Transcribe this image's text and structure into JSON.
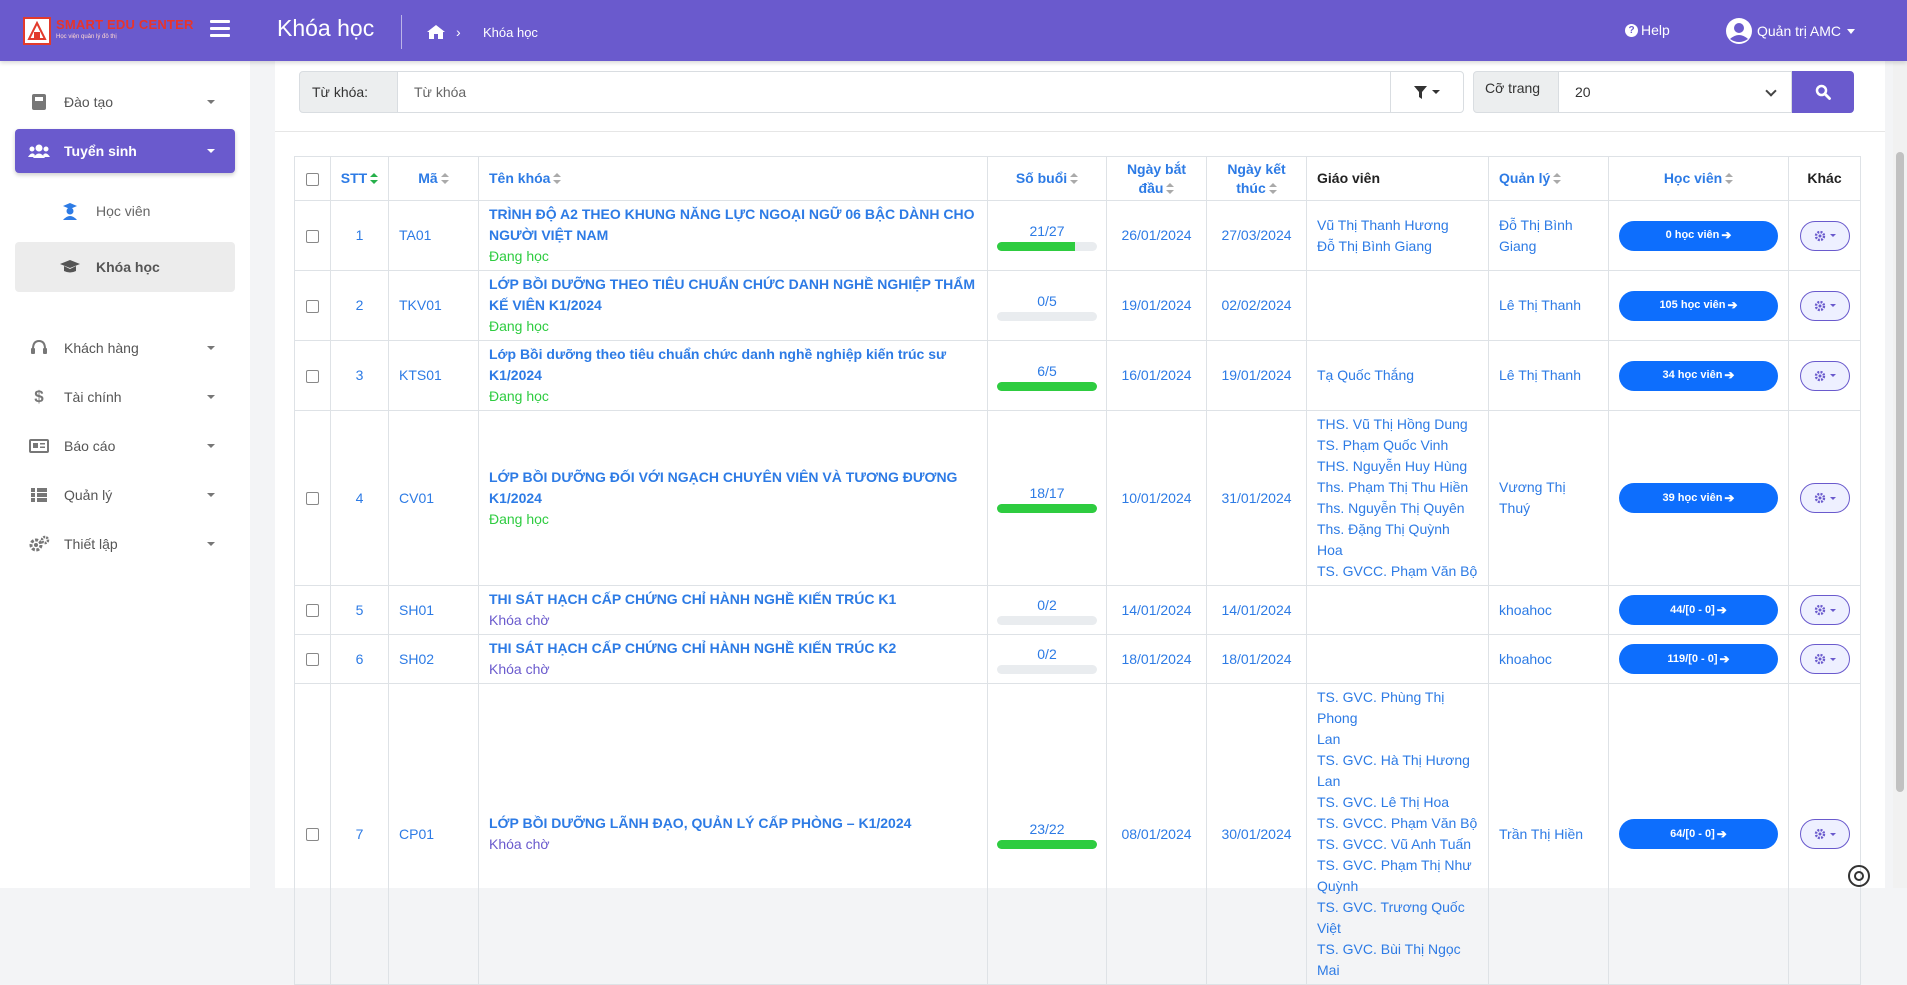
{
  "brand": {
    "title": "SMART EDU CENTER",
    "subtitle": "Học viện quản lý đô thị"
  },
  "header": {
    "page_title": "Khóa học",
    "breadcrumb_current": "Khóa học",
    "help": "Help",
    "user": "Quản trị AMC"
  },
  "sidebar": {
    "items": [
      {
        "label": "Đào tạo",
        "icon": "book-icon"
      },
      {
        "label": "Tuyển sinh",
        "icon": "users-icon",
        "active": true
      },
      {
        "label": "Khách hàng",
        "icon": "headset-icon"
      },
      {
        "label": "Tài chính",
        "icon": "dollar-icon"
      },
      {
        "label": "Báo cáo",
        "icon": "report-icon"
      },
      {
        "label": "Quản lý",
        "icon": "table-icon"
      },
      {
        "label": "Thiết lập",
        "icon": "cogs-icon"
      }
    ],
    "sub_items": [
      {
        "label": "Học viên",
        "icon": "student-icon"
      },
      {
        "label": "Khóa học",
        "icon": "graduation-cap-icon",
        "selected": true
      }
    ]
  },
  "filters": {
    "keyword_label": "Từ khóa:",
    "keyword_placeholder": "Từ khóa",
    "page_size_label": "Cỡ trang",
    "page_size_value": "20"
  },
  "colors": {
    "accent": "#6a5acd",
    "link": "#2d7be5",
    "progress": "#2ecc40",
    "button": "#0d6efd"
  },
  "table": {
    "headers": {
      "stt": "STT",
      "ma": "Mã",
      "ten_khoa": "Tên khóa",
      "so_buoi": "Số buổi",
      "ngay_bat_dau_1": "Ngày bắt",
      "ngay_bat_dau_2": "đầu",
      "ngay_ket_thuc_1": "Ngày kết",
      "ngay_ket_thuc_2": "thúc",
      "giao_vien": "Giáo viên",
      "quan_ly": "Quản lý",
      "hoc_vien": "Học viên",
      "khac": "Khác"
    },
    "rows": [
      {
        "stt": "1",
        "ma": "TA01",
        "name_lines": [
          "TRÌNH ĐỘ A2 THEO KHUNG NĂNG LỰC NGOẠI NGỮ 06 BẬC DÀNH CHO",
          "NGƯỜI VIỆT NAM"
        ],
        "status": "Đang học",
        "sessions": "21/27",
        "progress": 0.78,
        "start": "26/01/2024",
        "end": "27/03/2024",
        "teachers": [
          "Vũ Thị Thanh Hương",
          "Đỗ Thị Bình Giang"
        ],
        "manager_lines": [
          "Đỗ Thị Bình",
          "Giang"
        ],
        "students": "0 học viên"
      },
      {
        "stt": "2",
        "ma": "TKV01",
        "name_lines": [
          "LỚP BỒI DƯỠNG THEO TIÊU CHUẨN CHỨC DANH NGHỀ NGHIỆP THẨM",
          "KẾ VIÊN K1/2024"
        ],
        "status": "Đang học",
        "sessions": "0/5",
        "progress": 0,
        "start": "19/01/2024",
        "end": "02/02/2024",
        "teachers": [],
        "manager_lines": [
          "Lê Thị Thanh"
        ],
        "students": "105 học viên"
      },
      {
        "stt": "3",
        "ma": "KTS01",
        "name_lines": [
          "Lớp Bồi dưỡng theo tiêu chuẩn chức danh nghề nghiệp kiến trúc sư K1/2024"
        ],
        "status": "Đang học",
        "sessions": "6/5",
        "progress": 1,
        "start": "16/01/2024",
        "end": "19/01/2024",
        "teachers": [
          "Tạ Quốc Thắng"
        ],
        "manager_lines": [
          "Lê Thị Thanh"
        ],
        "students": "34 học viên"
      },
      {
        "stt": "4",
        "ma": "CV01",
        "name_lines": [
          "LỚP BỒI DƯỠNG ĐỐI VỚI NGẠCH CHUYÊN VIÊN VÀ TƯƠNG ĐƯƠNG",
          "K1/2024"
        ],
        "status": "Đang học",
        "sessions": "18/17",
        "progress": 1,
        "start": "10/01/2024",
        "end": "31/01/2024",
        "teachers": [
          "THS. Vũ Thị Hồng Dung",
          "TS. Phạm Quốc Vinh",
          "THS. Nguyễn Huy Hùng",
          "Ths. Phạm Thị Thu Hiền",
          "Ths. Nguyễn Thị Quyên",
          "Ths. Đặng Thị Quỳnh Hoa",
          "TS. GVCC. Phạm Văn Bộ"
        ],
        "manager_lines": [
          "Vương Thị",
          "Thuý"
        ],
        "students": "39 học viên"
      },
      {
        "stt": "5",
        "ma": "SH01",
        "name_lines": [
          "THI SÁT HẠCH CẤP CHỨNG CHỈ HÀNH NGHỀ KIẾN TRÚC K1"
        ],
        "status": "Khóa chờ",
        "sessions": "0/2",
        "progress": 0,
        "start": "14/01/2024",
        "end": "14/01/2024",
        "teachers": [],
        "manager_lines": [
          "khoahoc"
        ],
        "students": "44/[0 - 0]"
      },
      {
        "stt": "6",
        "ma": "SH02",
        "name_lines": [
          "THI SÁT HẠCH CẤP CHỨNG CHỈ HÀNH NGHỀ KIẾN TRÚC K2"
        ],
        "status": "Khóa chờ",
        "sessions": "0/2",
        "progress": 0,
        "start": "18/01/2024",
        "end": "18/01/2024",
        "teachers": [],
        "manager_lines": [
          "khoahoc"
        ],
        "students": "119/[0 - 0]"
      },
      {
        "stt": "7",
        "ma": "CP01",
        "name_lines": [
          "LỚP BỒI DƯỠNG LÃNH ĐẠO, QUẢN LÝ CẤP PHÒNG – K1/2024"
        ],
        "status": "Khóa chờ",
        "sessions": "23/22",
        "progress": 1,
        "start": "08/01/2024",
        "end": "30/01/2024",
        "teachers": [
          "TS. GVC. Phùng Thị Phong",
          "Lan",
          "TS. GVC. Hà Thị Hương",
          "Lan",
          "TS. GVC. Lê Thị Hoa",
          "TS. GVCC. Phạm Văn Bộ",
          "TS. GVCC. Vũ Anh Tuấn",
          "TS. GVC. Phạm Thị Như",
          "Quỳnh",
          "TS. GVC. Trương Quốc",
          "Việt",
          "TS. GVC. Bùi Thị Ngọc Mai"
        ],
        "manager_lines": [
          "Trần Thị Hiền"
        ],
        "students": "64/[0 - 0]"
      }
    ]
  }
}
